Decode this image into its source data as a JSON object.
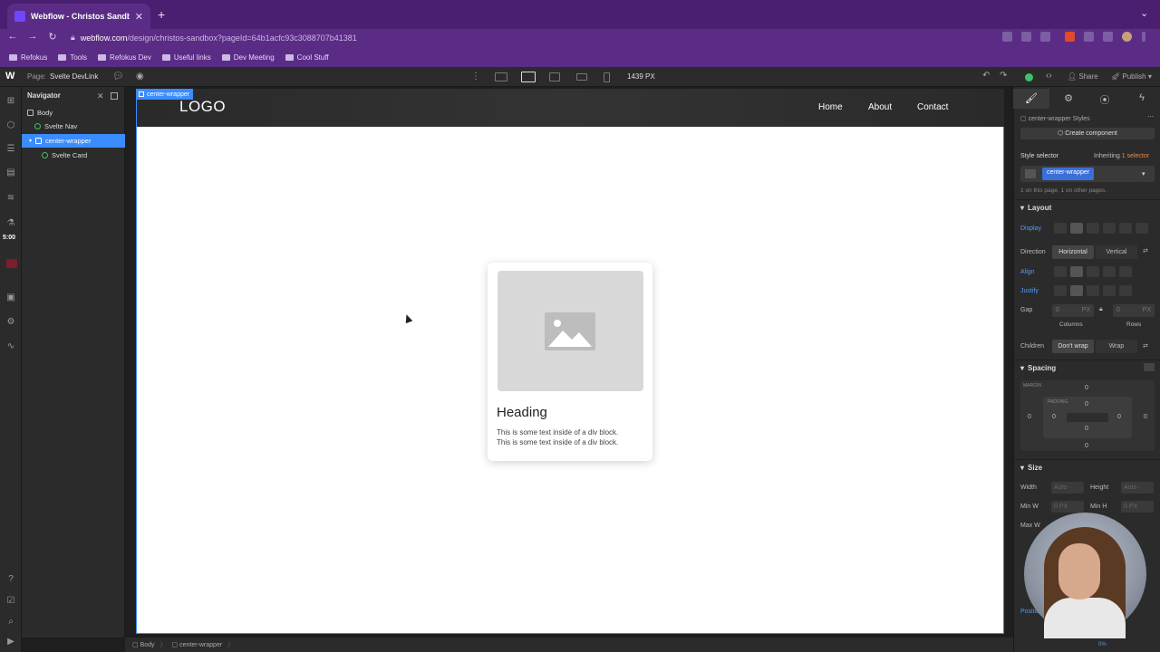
{
  "browser": {
    "tab_title": "Webflow - Christos Sandbox",
    "url_host": "webflow.com",
    "url_path": "/design/christos-sandbox?pageId=64b1acfc93c3088707b41381",
    "bookmarks": [
      "Refokus",
      "Tools",
      "Refokus Dev",
      "Useful links",
      "Dev Meeting",
      "Cool Stuff"
    ]
  },
  "wf_top": {
    "page_label": "Page:",
    "page_name": "Svelte DevLink",
    "width": "1439 PX",
    "share": "Share",
    "publish": "Publish"
  },
  "navigator": {
    "title": "Navigator",
    "items": [
      "Body",
      "Svelte Nav",
      "center-wrapper",
      "Svelte Card"
    ],
    "timer": "5:00"
  },
  "canvas": {
    "badge": "center-wrapper",
    "logo": "LOGO",
    "links": [
      "Home",
      "About",
      "Contact"
    ],
    "card_heading": "Heading",
    "card_text_1": "This is some text inside of a div block.",
    "card_text_2": "This is some text inside of a div block."
  },
  "breadcrumb": [
    "Body",
    "center-wrapper"
  ],
  "panel": {
    "class_name": "center-wrapper Styles",
    "create_component": "Create component",
    "style_selector": "Style selector",
    "inheriting": "Inheriting",
    "inheriting_count": "1 selector",
    "selector_tag": "center-wrapper",
    "usage": "1 on this page, 1 on other pages.",
    "layout": "Layout",
    "display": "Display",
    "direction": "Direction",
    "horizontal": "Horizontal",
    "vertical": "Vertical",
    "align": "Align",
    "justify": "Justify",
    "gap": "Gap",
    "gap_col": "0",
    "gap_row": "0",
    "px": "PX",
    "columns": "Columns",
    "rows": "Rows",
    "children": "Children",
    "dont_wrap": "Don't wrap",
    "wrap": "Wrap",
    "spacing": "Spacing",
    "margin": "MARGIN",
    "padding": "PADDING",
    "zero": "0",
    "size": "Size",
    "width": "Width",
    "height": "Height",
    "auto": "Auto",
    "min_w": "Min W",
    "min_h": "Min H",
    "max_w": "Max W",
    "none": "None",
    "position": "Position",
    "percent": "0%"
  }
}
